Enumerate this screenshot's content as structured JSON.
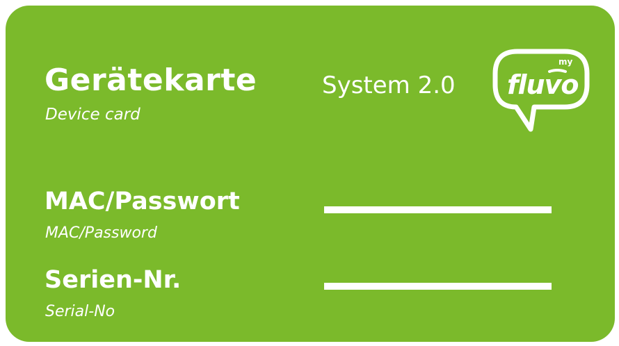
{
  "card": {
    "title": "Gerätekarte",
    "subtitle": "Device card",
    "system": "System 2.0",
    "background_color": "#7bba2b"
  },
  "logo": {
    "brand": "fluvo",
    "prefix": "my",
    "icon": "speech-bubble-logo"
  },
  "fields": {
    "mac": {
      "label": "MAC/Passwort",
      "sublabel": "MAC/Password",
      "value": ""
    },
    "serial": {
      "label": "Serien-Nr.",
      "sublabel": "Serial-No",
      "value": ""
    }
  }
}
